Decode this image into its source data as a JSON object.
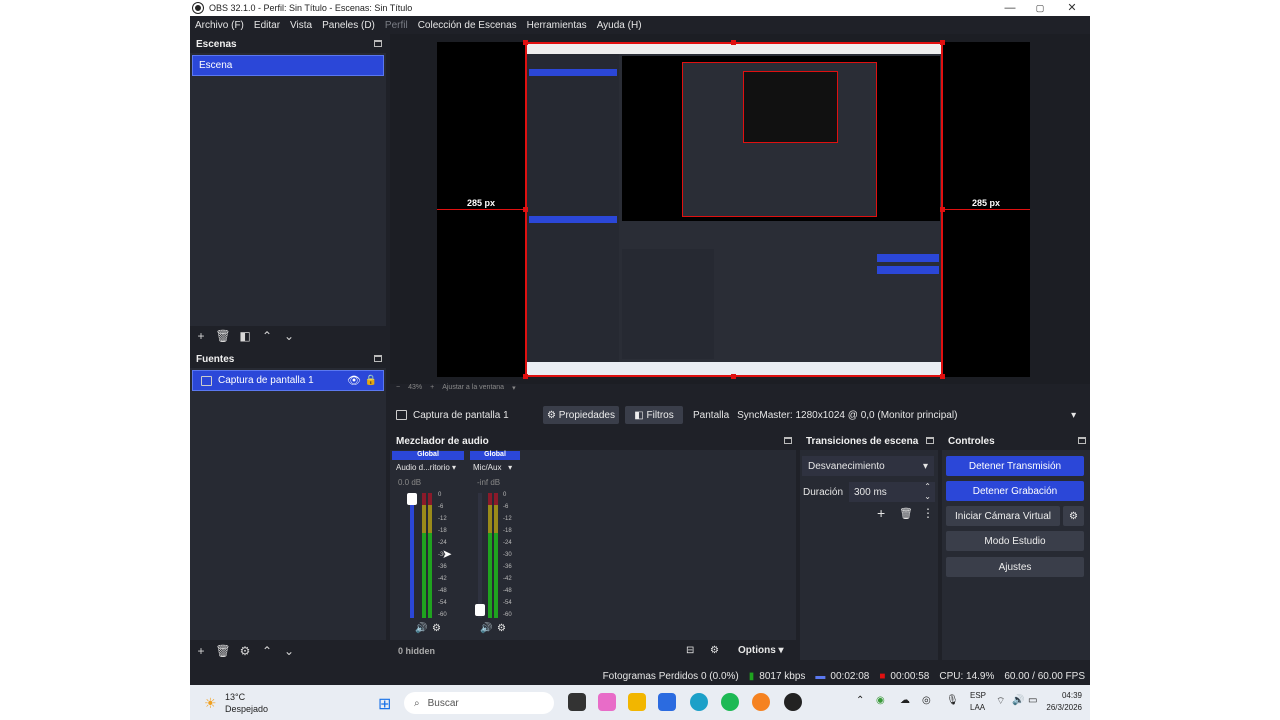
{
  "window": {
    "title": "OBS 32.1.0 - Perfil: Sin Título - Escenas: Sin Título",
    "minimize": "—",
    "maximize": "▢",
    "close": "✕"
  },
  "menu": [
    "Archivo (F)",
    "Editar",
    "Vista",
    "Paneles (D)",
    "Perfil",
    "Colección de Escenas",
    "Herramientas",
    "Ayuda (H)"
  ],
  "scenes": {
    "title": "Escenas",
    "items": [
      "Escena"
    ]
  },
  "sources": {
    "title": "Fuentes",
    "items": [
      "Captura de pantalla 1"
    ]
  },
  "preview": {
    "left_px": "285 px",
    "right_px": "285 px",
    "zoom": "43%",
    "fit": "Ajustar a la ventana"
  },
  "source_bar": {
    "source": "Captura de pantalla 1",
    "properties": "Propiedades",
    "filters": "Filtros",
    "display_label": "Pantalla",
    "display_value": "SyncMaster: 1280x1024 @ 0,0 (Monitor principal)"
  },
  "mixer": {
    "title": "Mezclador de audio",
    "channels": [
      {
        "global": "Global",
        "name": "Audio d...ritorio",
        "db": "0.0 dB"
      },
      {
        "global": "Global",
        "name": "Mic/Aux",
        "db": "-inf dB"
      }
    ],
    "scale": [
      "0",
      "-6",
      "-12",
      "-18",
      "-24",
      "-30",
      "-36",
      "-42",
      "-48",
      "-54",
      "-60"
    ],
    "hidden": "0 hidden",
    "options": "Options"
  },
  "transitions": {
    "title": "Transiciones de escena",
    "type": "Desvanecimiento",
    "duration_label": "Duración",
    "duration_value": "300 ms"
  },
  "controls": {
    "title": "Controles",
    "stop_stream": "Detener Transmisión",
    "stop_record": "Detener Grabación",
    "virtual_cam": "Iniciar Cámara Virtual",
    "studio": "Modo Estudio",
    "settings": "Ajustes"
  },
  "status": {
    "dropped": "Fotogramas Perdidos 0 (0.0%)",
    "bitrate": "8017 kbps",
    "stream_time": "00:02:08",
    "rec_time": "00:00:58",
    "cpu": "CPU: 14.9%",
    "fps": "60.00 / 60.00 FPS"
  },
  "taskbar": {
    "weather_temp": "13°C",
    "weather_desc": "Despejado",
    "search": "Buscar",
    "lang1": "ESP",
    "lang2": "LAA",
    "time": "04:39",
    "date": "26/3/2026"
  },
  "colors": {
    "accent": "#2b47d8",
    "record_red": "#e01010",
    "meter_green": "#1fa31f",
    "meter_yellow": "#9a8a1a",
    "meter_red": "#8a1a2a"
  }
}
